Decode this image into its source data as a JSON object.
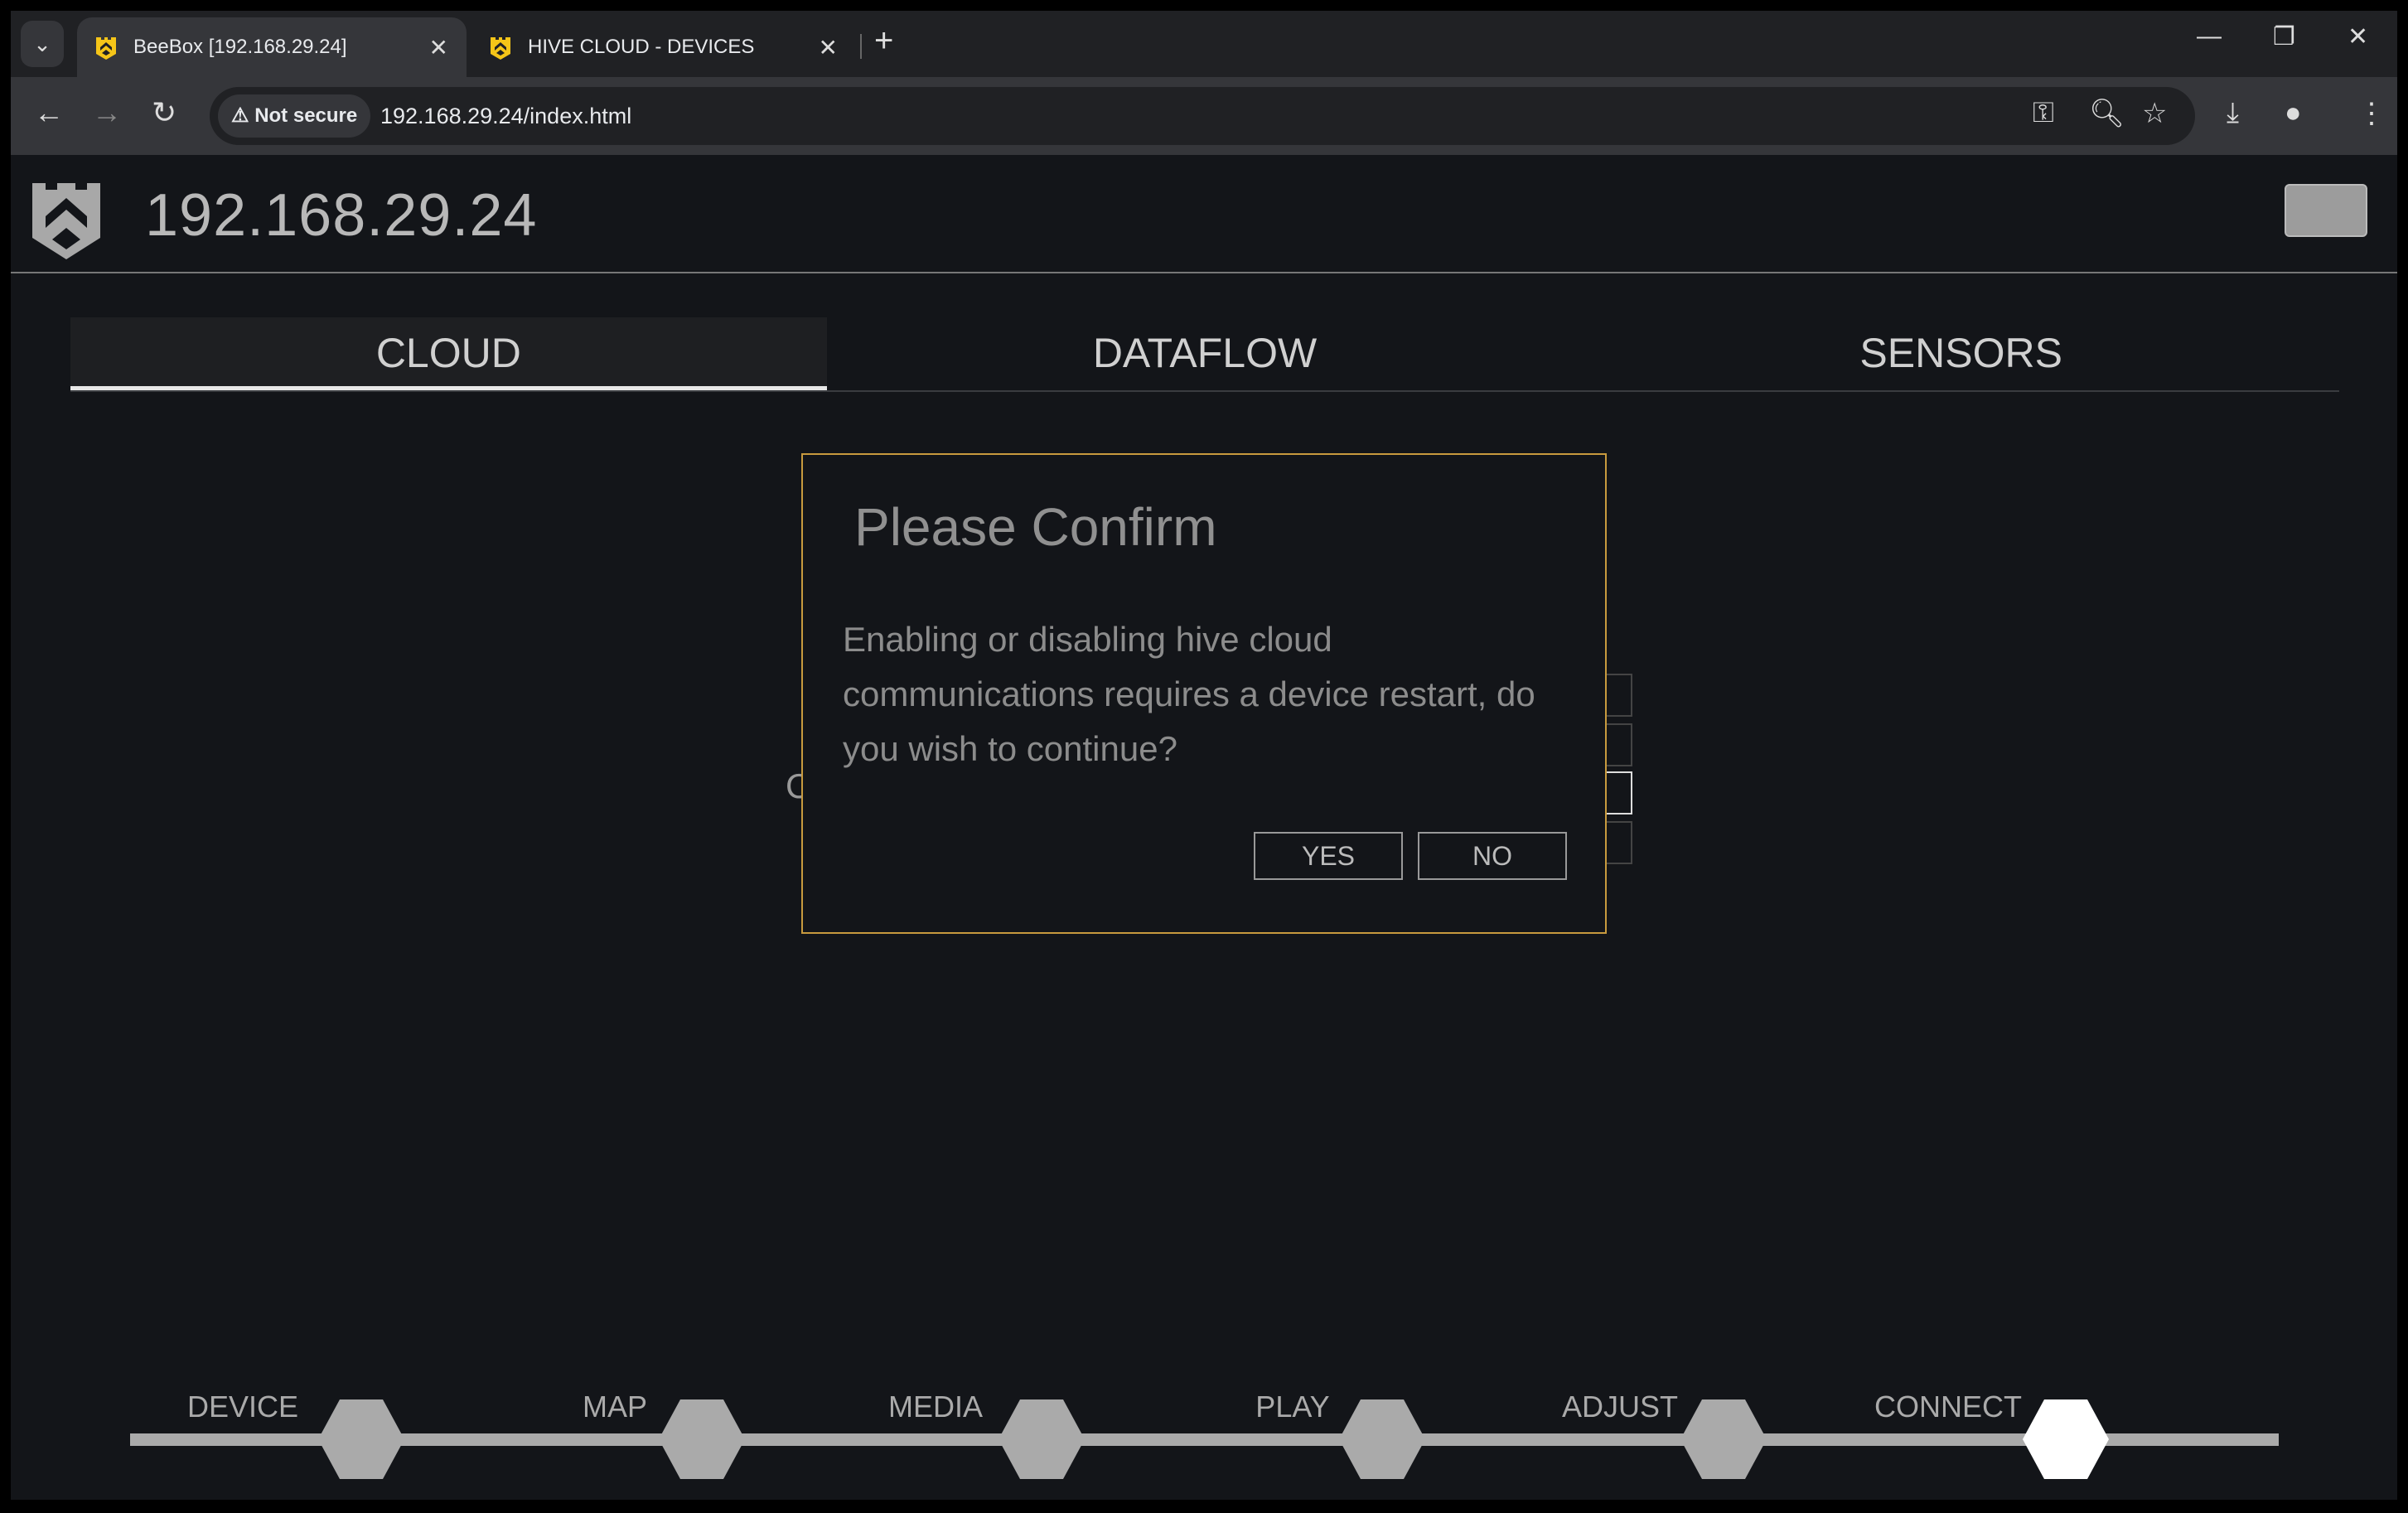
{
  "browser": {
    "tabs": [
      {
        "title": "BeeBox [192.168.29.24]",
        "active": true
      },
      {
        "title": "HIVE CLOUD - DEVICES",
        "active": false
      }
    ],
    "security_label": "Not secure",
    "url": "192.168.29.24/index.html",
    "favicon_color": "#f5c518"
  },
  "header": {
    "title": "192.168.29.24"
  },
  "tabs": [
    {
      "label": "CLOUD",
      "active": true
    },
    {
      "label": "DATAFLOW"
    },
    {
      "label": "SENSORS"
    }
  ],
  "background_partial_text": "C",
  "dialog": {
    "title": "Please Confirm",
    "message": "Enabling or disabling hive cloud communications requires a device restart, do you wish to continue?",
    "yes_label": "YES",
    "no_label": "NO",
    "border_color": "#c89a3e"
  },
  "bottom_nav": {
    "items": [
      {
        "label": "DEVICE"
      },
      {
        "label": "MAP"
      },
      {
        "label": "MEDIA"
      },
      {
        "label": "PLAY"
      },
      {
        "label": "ADJUST"
      },
      {
        "label": "CONNECT",
        "active": true
      }
    ]
  }
}
